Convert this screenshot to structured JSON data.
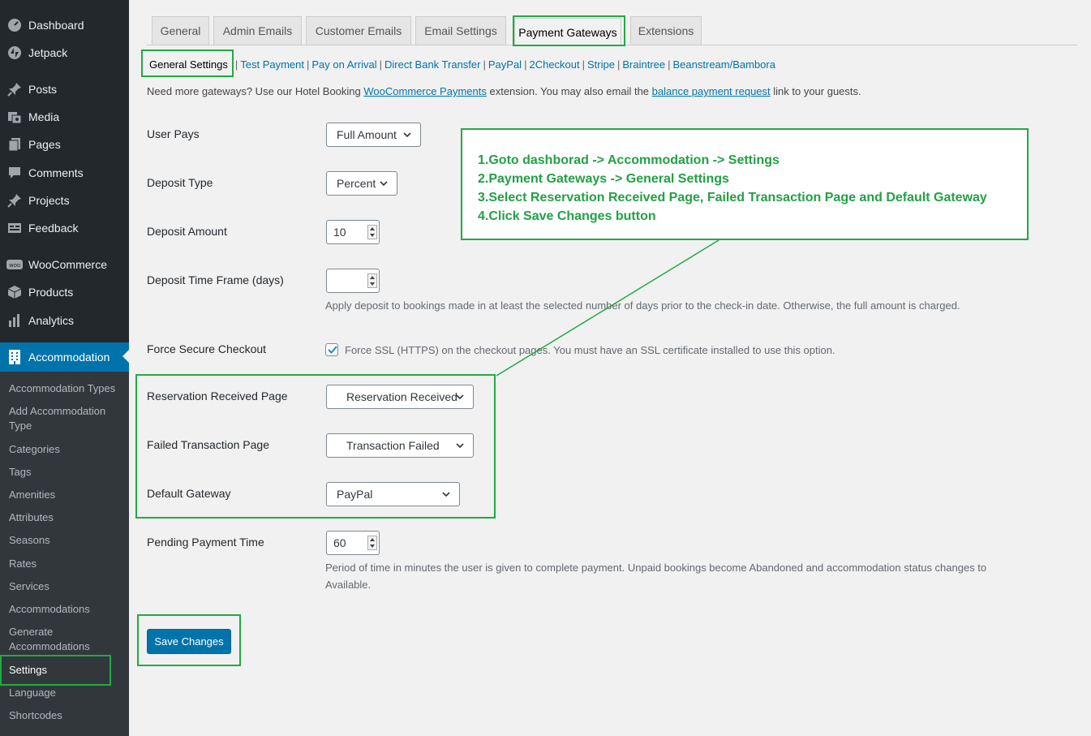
{
  "sidebar": {
    "items": [
      {
        "label": "Dashboard",
        "icon": "dashboard-icon"
      },
      {
        "label": "Jetpack",
        "icon": "jetpack-icon"
      },
      {
        "label": "Posts",
        "icon": "pin-icon"
      },
      {
        "label": "Media",
        "icon": "media-icon"
      },
      {
        "label": "Pages",
        "icon": "pages-icon"
      },
      {
        "label": "Comments",
        "icon": "comment-icon"
      },
      {
        "label": "Projects",
        "icon": "pin-icon"
      },
      {
        "label": "Feedback",
        "icon": "feedback-icon"
      },
      {
        "label": "WooCommerce",
        "icon": "woocommerce-icon"
      },
      {
        "label": "Products",
        "icon": "box-icon"
      },
      {
        "label": "Analytics",
        "icon": "bar-chart-icon"
      },
      {
        "label": "Accommodation",
        "icon": "building-icon"
      }
    ],
    "submenu": [
      "Accommodation Types",
      "Add Accommodation Type",
      "Categories",
      "Tags",
      "Amenities",
      "Attributes",
      "Seasons",
      "Rates",
      "Services",
      "Accommodations",
      "Generate Accommodations",
      "Settings",
      "Language",
      "Shortcodes"
    ]
  },
  "tabs": [
    "General",
    "Admin Emails",
    "Customer Emails",
    "Email Settings",
    "Payment Gateways",
    "Extensions"
  ],
  "subnav": {
    "current": "General Settings",
    "links": [
      "Test Payment",
      "Pay on Arrival",
      "Direct Bank Transfer",
      "PayPal",
      "2Checkout",
      "Stripe",
      "Braintree",
      "Beanstream/Bambora"
    ]
  },
  "info": {
    "part1": "Need more gateways? Use our Hotel Booking ",
    "link1": "WooCommerce Payments",
    "part2": " extension. You may also email the ",
    "link2": "balance payment request",
    "part3": " link to your guests."
  },
  "form": {
    "user_pays": {
      "label": "User Pays",
      "value": "Full Amount"
    },
    "deposit_type": {
      "label": "Deposit Type",
      "value": "Percent"
    },
    "deposit_amount": {
      "label": "Deposit Amount",
      "value": "10"
    },
    "deposit_time": {
      "label": "Deposit Time Frame (days)",
      "value": "",
      "desc": "Apply deposit to bookings made in at least the selected number of days prior to the check-in date. Otherwise, the full amount is charged."
    },
    "force_secure": {
      "label": "Force Secure Checkout",
      "checked": true,
      "desc": "Force SSL (HTTPS) on the checkout pages. You must have an SSL certificate installed to use this option."
    },
    "reservation_page": {
      "label": "Reservation Received Page",
      "value": "Reservation Received"
    },
    "failed_page": {
      "label": "Failed Transaction Page",
      "value": "Transaction Failed"
    },
    "default_gateway": {
      "label": "Default Gateway",
      "value": "PayPal"
    },
    "pending_time": {
      "label": "Pending Payment Time",
      "value": "60",
      "desc1": "Period of time in minutes the user is given to complete payment. Unpaid bookings become Abandoned and accommodation status changes to",
      "desc2": "Available."
    }
  },
  "save_label": "Save Changes",
  "note": [
    "1.Goto dashborad -> Accommodation -> Settings",
    "2.Payment Gateways -> General Settings",
    "3.Select Reservation Received Page, Failed Transaction Page and Default Gateway",
    "4.Click Save Changes button"
  ],
  "colors": {
    "accent": "#0073aa",
    "highlight": "#22aa44",
    "sidebar": "#23282d"
  }
}
